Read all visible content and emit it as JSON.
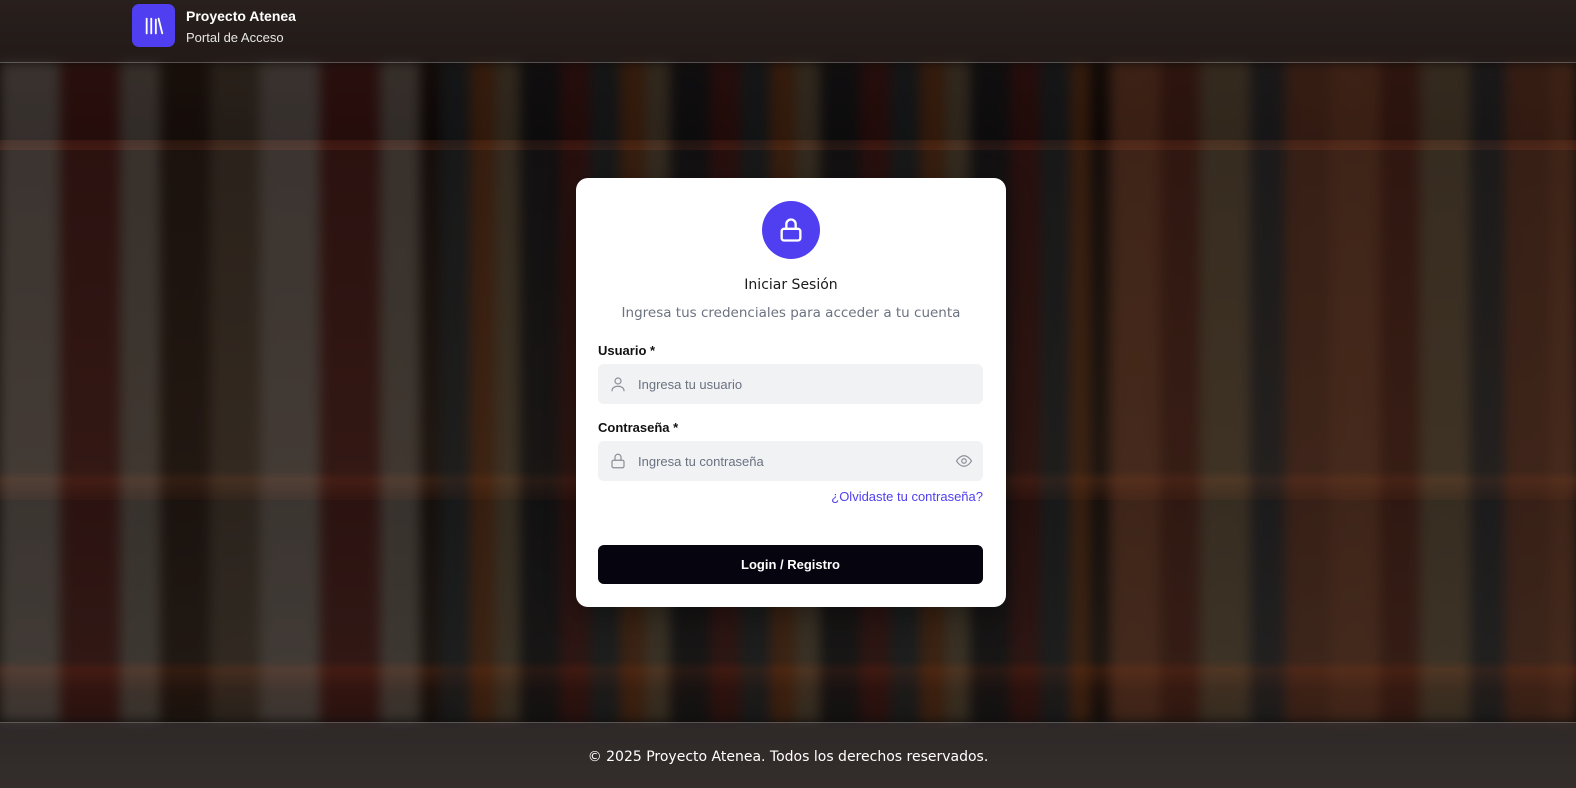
{
  "header": {
    "title": "Proyecto Atenea",
    "subtitle": "Portal de Acceso",
    "logo_icon": "library-books-icon",
    "logo_color": "#4f3ff0"
  },
  "login": {
    "lock_icon": "lock-icon",
    "title": "Iniciar Sesión",
    "subtitle": "Ingresa tus credenciales para acceder a tu cuenta",
    "username": {
      "label": "Usuario *",
      "placeholder": "Ingresa tu usuario",
      "value": "",
      "icon": "user-icon"
    },
    "password": {
      "label": "Contraseña *",
      "placeholder": "Ingresa tu contraseña",
      "value": "",
      "icon": "lock-icon",
      "toggle_icon": "eye-icon"
    },
    "forgot_link": "¿Olvidaste tu contraseña?",
    "submit_label": "Login / Registro"
  },
  "footer": {
    "text": "© 2025 Proyecto Atenea. Todos los derechos reservados."
  },
  "colors": {
    "accent": "#4f3ff0",
    "button": "#05040f",
    "input_bg": "#f1f2f4"
  }
}
